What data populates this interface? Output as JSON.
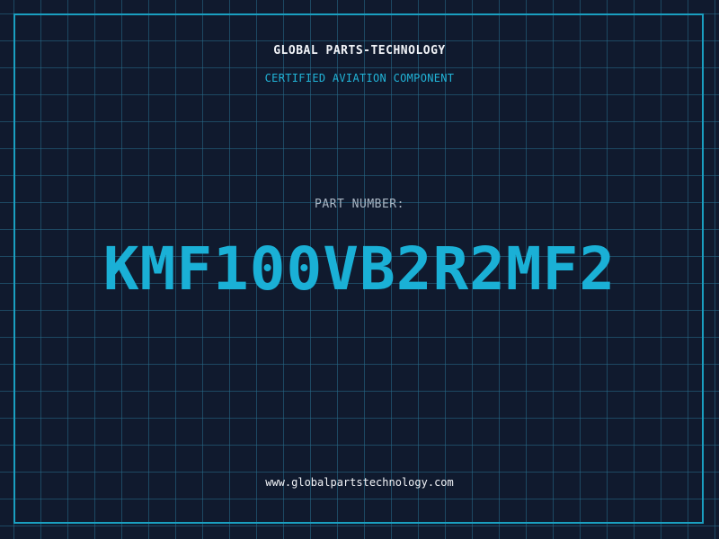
{
  "header": {
    "company": "GLOBAL PARTS-TECHNOLOGY",
    "subtitle": "CERTIFIED AVIATION COMPONENT"
  },
  "part": {
    "label": "PART NUMBER:",
    "number": "KMF100VB2R2MF2"
  },
  "footer": {
    "website": "www.globalpartstechnology.com"
  },
  "colors": {
    "background": "#101a2e",
    "grid": "#286e8c",
    "accent": "#1ab0d6",
    "text": "#f2f4f8"
  }
}
